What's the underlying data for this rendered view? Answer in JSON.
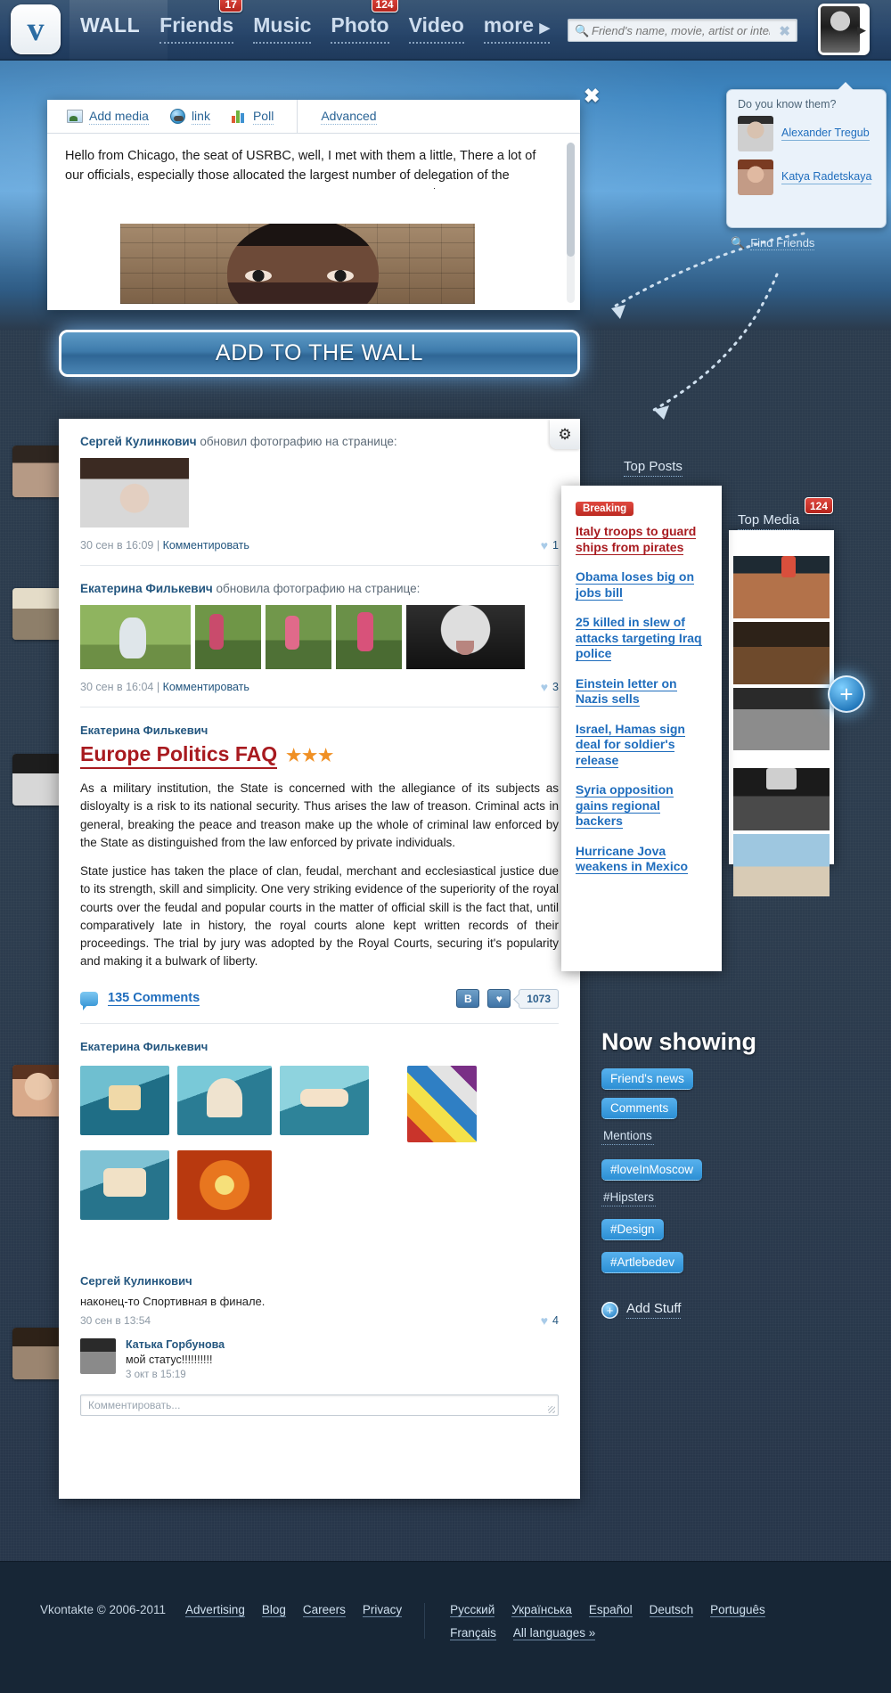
{
  "header": {
    "logo": "v",
    "nav": [
      {
        "label": "WALL",
        "badge": null,
        "active": true
      },
      {
        "label": "Friends",
        "badge": "17"
      },
      {
        "label": "Music",
        "badge": null
      },
      {
        "label": "Photo",
        "badge": "124"
      },
      {
        "label": "Video",
        "badge": null
      },
      {
        "label": "more",
        "badge": null,
        "caret": "▶"
      }
    ],
    "search": {
      "placeholder": "Friend's name, movie, artist or interst",
      "value": "",
      "icon": "search-icon",
      "clear": "✖"
    },
    "avatar_arrow": "▶"
  },
  "composer": {
    "close": "✖",
    "tools": [
      {
        "label": "Add media",
        "icon": "image-icon"
      },
      {
        "label": "link",
        "icon": "globe-link-icon"
      },
      {
        "label": "Poll",
        "icon": "bar-chart-icon"
      }
    ],
    "advanced_label": "Advanced",
    "text": "Hello from Chicago, the seat of USRBC, well, I met with them a little, There a lot of our officials, especially those allocated the largest number of delegation of the Chelyabinsk region, led by my favorite — the governor Jurewicz."
  },
  "cta": {
    "label": "ADD TO THE WALL"
  },
  "know_them": {
    "title": "Do you know them?",
    "people": [
      {
        "name": "Alexander Tregub"
      },
      {
        "name": "Katya Radetskaya"
      }
    ],
    "find_friends": "Find Friends"
  },
  "feed": {
    "gear_icon": "gear-icon",
    "posts": [
      {
        "author": "Сергей Кулинкович",
        "action": "обновил фотографию на странице:",
        "time": "30 сен в 16:09",
        "comment_link": "Комментировать",
        "likes": "1"
      },
      {
        "author": "Екатерина Филькевич",
        "action": "обновила фотографию на странице:",
        "time": "30 сен в 16:04",
        "comment_link": "Комментировать",
        "likes": "3"
      }
    ],
    "article": {
      "author": "Екатерина Филькевич",
      "title": "Europe Politics FAQ",
      "stars": "★★★",
      "paragraph1": "As a military institution, the State is concerned with the allegiance of its subjects as disloyalty is a risk to its national security. Thus arises the law of treason. Criminal acts in general, breaking the peace and treason make up the whole of criminal law enforced by the State as distinguished from the law enforced by private individuals.",
      "paragraph2": "State justice has taken the place of clan, feudal, merchant and ecclesiastical justice due to its strength, skill and simplicity. One very striking evidence of the superiority of the royal courts over the feudal and popular courts in the matter of official skill is the fact that, until comparatively late in history, the royal courts alone kept written records of their proceedings. The trial by jury was adopted by the Royal Courts, securing it's popularity and making it a bulwark of liberty.",
      "comments_label": "135 Comments",
      "share_btn": "B",
      "like_btn": "♥",
      "counter": "1073"
    },
    "gallery_post": {
      "author": "Екатерина Филькевич"
    },
    "status_post": {
      "author": "Сергей Кулинкович",
      "text": "наконец-то Спортивная в финале.",
      "time": "30 сен в 13:54",
      "likes": "4",
      "comment": {
        "author": "Катька Горбунова",
        "text": "мой статус!!!!!!!!!!",
        "time": "3 окт в 15:19"
      },
      "comment_placeholder": "Комментировать..."
    }
  },
  "top_posts": {
    "label": "Top Posts",
    "breaking_badge": "Breaking",
    "items": [
      {
        "text": "Italy troops to guard ships from pirates",
        "style": "red"
      },
      {
        "text": "Obama loses big on jobs bill",
        "style": "blue"
      },
      {
        "text": "25 killed in slew of attacks targeting Iraq police",
        "style": "blue"
      },
      {
        "text": "Einstein letter on Nazis sells",
        "style": "blue"
      },
      {
        "text": "Israel, Hamas sign deal for soldier's release",
        "style": "blue"
      },
      {
        "text": "Syria opposition gains regional backers",
        "style": "blue"
      },
      {
        "text": "Hurricane Jova weakens in Mexico",
        "style": "blue"
      }
    ]
  },
  "top_media": {
    "label": "Top Media",
    "badge": "124",
    "plus_button": "+"
  },
  "now_showing": {
    "title": "Now showing",
    "tags": [
      {
        "label": "Friend's news",
        "active": true
      },
      {
        "label": "Comments",
        "active": true
      },
      {
        "label": "Mentions",
        "active": false
      },
      {
        "label": "#loveInMoscow",
        "active": true
      },
      {
        "label": "#Hipsters",
        "active": false
      },
      {
        "label": "#Design",
        "active": true
      },
      {
        "label": "#Artlebedev",
        "active": true
      }
    ],
    "add_stuff": "Add Stuff",
    "add_icon": "plus-circle-icon"
  },
  "footer": {
    "copyright": "Vkontakte © 2006-2011",
    "links": [
      "Advertising",
      "Blog",
      "Careers",
      "Privacy"
    ],
    "languages_row1": [
      "Русский",
      "Українська",
      "Español",
      "Deutsch",
      "Português"
    ],
    "languages_row2": [
      "Français",
      "All languages »"
    ]
  },
  "colors": {
    "accent": "#1f6dbd",
    "brand_dark": "#1f3a5c",
    "badge_red": "#c22b22",
    "article_red": "#a81a1f",
    "star_orange": "#f09024"
  }
}
